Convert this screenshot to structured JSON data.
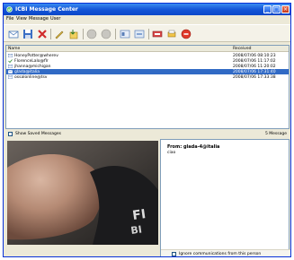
{
  "window": {
    "title": "ICBI Message Center"
  },
  "titlebar_buttons": {
    "minimize": "_",
    "maximize": "□",
    "close": "×"
  },
  "menu": [
    "File",
    "View",
    "Message",
    "User"
  ],
  "toolbar": [
    "new-message-icon",
    "save-icon",
    "delete-icon",
    "edit-icon",
    "attach-icon",
    "play-icon",
    "stop-icon",
    "contacts-icon",
    "refresh-icon",
    "mailbox-icon",
    "print-icon",
    "block-icon"
  ],
  "list": {
    "columns": {
      "name": "Name",
      "received": "Received"
    },
    "rows": [
      {
        "name": "HoneyPotter@wherev",
        "received": "2008/07/06 08:10:23",
        "selected": false
      },
      {
        "name": "FlorenceLalo@flr",
        "received": "2008/07/06 11:17:02",
        "selected": false
      },
      {
        "name": "jhanna@michigan",
        "received": "2008/07/06 11:20:02",
        "selected": false
      },
      {
        "name": "glada@italia",
        "received": "2008/07/06 17:31:40",
        "selected": true
      },
      {
        "name": "ossalonline@tsv",
        "received": "2008/07/06 17:33:38",
        "selected": false
      }
    ]
  },
  "status": {
    "show_saved_label": "Show Saved Messages",
    "count": "5 Message"
  },
  "message": {
    "from": "From: glada-4@italia",
    "body": "ciao",
    "ignore_label": "Ignore communications from this person"
  }
}
